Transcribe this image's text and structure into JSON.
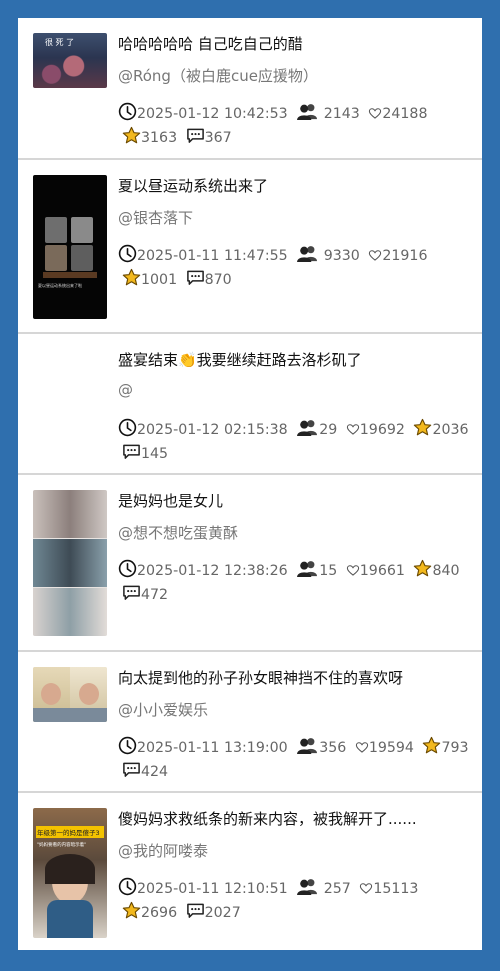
{
  "posts": [
    {
      "title": "哈哈哈哈哈 自己吃自己的醋",
      "author": "@Róng（被白鹿cue应援物）",
      "date": "2025-01-12 10:42:53",
      "viewers": "2143",
      "likes": "24188",
      "stars": "3163",
      "comments": "367",
      "thumb_text": "很 死 了"
    },
    {
      "title": "夏以昼运动系统出来了",
      "author": "@银杏落下",
      "date": "2025-01-11 11:47:55",
      "viewers": "9330",
      "likes": "21916",
      "stars": "1001",
      "comments": "870",
      "thumb_text": "夏以昼运动系统出来了啦"
    },
    {
      "title": "盛宴结束👏我要继续赶路去洛杉矶了",
      "author": "@",
      "date": "2025-01-12 02:15:38",
      "viewers": "29",
      "likes": "19692",
      "stars": "2036",
      "comments": "145"
    },
    {
      "title": "是妈妈也是女儿",
      "author": "@想不想吃蛋黄酥",
      "date": "2025-01-12 12:38:26",
      "viewers": "15",
      "likes": "19661",
      "stars": "840",
      "comments": "472"
    },
    {
      "title": "向太提到他的孙子孙女眼神挡不住的喜欢呀",
      "author": "@小小爱娱乐",
      "date": "2025-01-11 13:19:00",
      "viewers": "356",
      "likes": "19594",
      "stars": "793",
      "comments": "424"
    },
    {
      "title": "傻妈妈求救纸条的新来内容，被我解开了......",
      "author": "@我的阿喽泰",
      "date": "2025-01-11 12:10:51",
      "viewers": "257",
      "likes": "15113",
      "stars": "2696",
      "comments": "2027",
      "thumb_text": "年级第一的妈是傻子3",
      "thumb_sub": "\"妈妈要看的内容暗示着\""
    }
  ],
  "colors": {
    "background": "#2f6fae",
    "card": "#ffffff",
    "star": "#f2b81d"
  },
  "icons": [
    "clock-icon",
    "people-icon",
    "heart-icon",
    "star-icon",
    "comment-icon"
  ]
}
